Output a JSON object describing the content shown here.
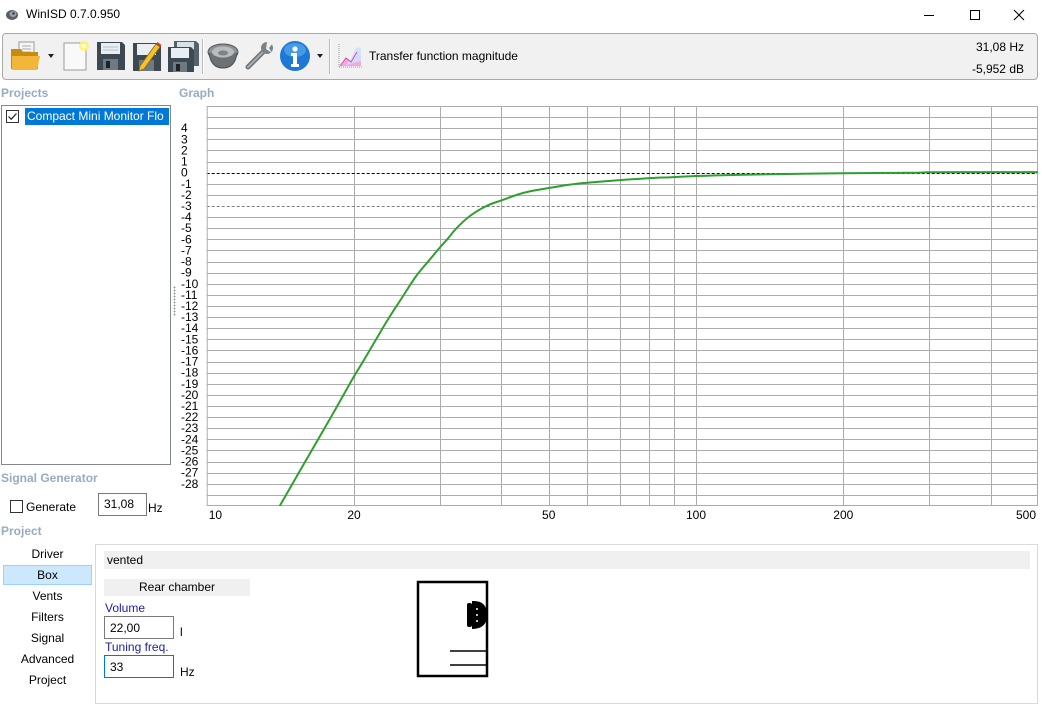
{
  "window": {
    "title": "WinISD 0.7.0.950",
    "icon": "app-speaker-icon",
    "controls": [
      "minimize-icon",
      "maximize-icon",
      "close-icon"
    ]
  },
  "toolbar": {
    "buttons": [
      {
        "id": "open",
        "icon": "open-folder-icon",
        "has_dropdown": true
      },
      {
        "id": "new",
        "icon": "new-document-icon"
      },
      {
        "id": "save",
        "icon": "save-icon"
      },
      {
        "id": "save_as",
        "icon": "save-as-icon"
      },
      {
        "id": "save_all",
        "icon": "save-all-icon"
      },
      {
        "id": "driver_editor",
        "icon": "speaker-driver-icon"
      },
      {
        "id": "options",
        "icon": "wrench-icon"
      },
      {
        "id": "about",
        "icon": "info-icon",
        "has_dropdown": true
      }
    ],
    "graph_selector": {
      "icon": "chart-icon",
      "label": "Transfer function magnitude"
    },
    "cursor": {
      "frequency": "31,08 Hz",
      "value": "-5,952 dB"
    }
  },
  "projects": {
    "title": "Projects",
    "items": [
      {
        "label": "Compact Mini Monitor Flo",
        "checked": true,
        "selected": true
      }
    ]
  },
  "graph": {
    "title": "Graph"
  },
  "signal_generator": {
    "title": "Signal Generator",
    "generate_label": "Generate",
    "generate_checked": false,
    "frequency": "31,08",
    "unit": "Hz"
  },
  "project": {
    "title": "Project",
    "nav": [
      "Driver",
      "Box",
      "Vents",
      "Filters",
      "Signal",
      "Advanced",
      "Project"
    ],
    "active": "Box",
    "box": {
      "type": "vented",
      "chamber_header": "Rear chamber",
      "volume_label": "Volume",
      "volume_value": "22,00",
      "volume_unit": "l",
      "tuning_label": "Tuning freq.",
      "tuning_value": "33",
      "tuning_unit": "Hz"
    }
  },
  "colors": {
    "selection": "#0078d7",
    "section_label": "#97abc3",
    "field_label": "#1c1ca8",
    "grid": "#acacac"
  },
  "chart_data": {
    "type": "line",
    "title": "Transfer function magnitude",
    "xlabel": "",
    "ylabel": "",
    "xscale": "log",
    "xlim": [
      10,
      500
    ],
    "ylim": [
      -30,
      6
    ],
    "grid": true,
    "legend": "none",
    "x_ticks": [
      10,
      20,
      50,
      100,
      200,
      500
    ],
    "x_gridlines": [
      20,
      30,
      40,
      50,
      60,
      70,
      80,
      90,
      100,
      200,
      300,
      400
    ],
    "y_ticks": [
      4,
      3,
      2,
      1,
      0,
      -1,
      -2,
      -3,
      -4,
      -5,
      -6,
      -7,
      -8,
      -9,
      -10,
      -11,
      -12,
      -13,
      -14,
      -15,
      -16,
      -17,
      -18,
      -19,
      -20,
      -21,
      -22,
      -23,
      -24,
      -25,
      -26,
      -27,
      -28
    ],
    "reference_lines": [
      {
        "y": 0,
        "style": "dashed",
        "color": "#000000"
      },
      {
        "y": -3,
        "style": "dashed",
        "color": "#808080"
      }
    ],
    "series": [
      {
        "name": "Compact Mini Monitor Flo",
        "color": "#2f9f2f",
        "x": [
          14.1,
          16,
          18,
          19.9,
          21.0,
          22.6,
          23.7,
          25.2,
          26.8,
          28.6,
          30.0,
          31.08,
          32.4,
          34.5,
          37.3,
          40,
          44.3,
          50,
          55,
          60,
          70,
          80,
          90,
          100,
          125,
          165,
          200,
          280,
          300,
          400,
          500
        ],
        "y": [
          -30,
          -25.8,
          -21.9,
          -18.5,
          -16.8,
          -14.4,
          -12.9,
          -11.1,
          -9.3,
          -7.8,
          -6.7,
          -5.95,
          -5.0,
          -3.9,
          -3.0,
          -2.5,
          -1.83,
          -1.38,
          -1.08,
          -0.9,
          -0.67,
          -0.5,
          -0.4,
          -0.3,
          -0.18,
          -0.1,
          -0.05,
          0.0,
          0.03,
          0.05,
          0.05
        ]
      }
    ]
  }
}
